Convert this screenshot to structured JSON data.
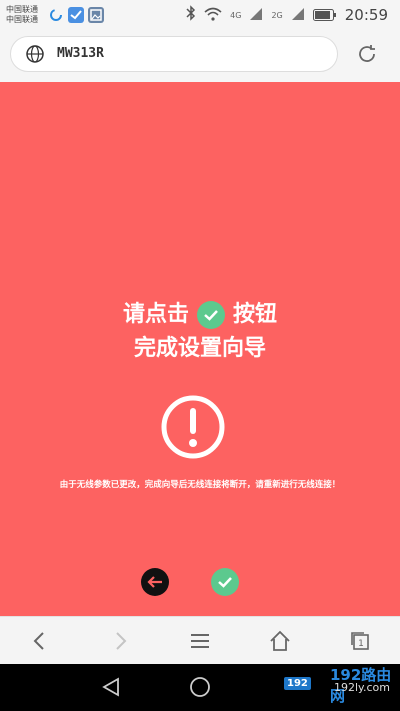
{
  "status_bar": {
    "carrier_1": "中国联通",
    "carrier_2": "中国联通",
    "network_1": "4G",
    "network_2": "2G",
    "time": "20:59"
  },
  "browser": {
    "url": "MW313R"
  },
  "main": {
    "instruction_line1_before": "请点击",
    "instruction_line1_after": "按钮",
    "instruction_line2": "完成设置向导",
    "message": "由于无线参数已更改，完成向导后无线连接将断开，请重新进行无线连接！",
    "colors": {
      "background": "#fd6261",
      "confirm": "#5cc98e",
      "back": "#111111"
    }
  },
  "watermark": {
    "logo": "192",
    "url": "192ly.com",
    "title": "192路由网"
  }
}
